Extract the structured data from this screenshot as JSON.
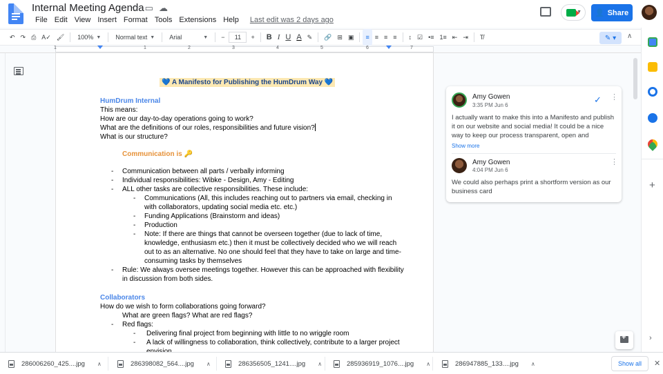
{
  "app": {
    "doc_title": "Internal Meeting Agenda",
    "menu": [
      "File",
      "Edit",
      "View",
      "Insert",
      "Format",
      "Tools",
      "Extensions",
      "Help"
    ],
    "last_edit": "Last edit was 2 days ago",
    "share_label": "Share"
  },
  "toolbar": {
    "zoom": "100%",
    "style": "Normal text",
    "font": "Arial",
    "font_size": "11",
    "bold": "B",
    "italic": "I",
    "underline": "U",
    "text_color": "A"
  },
  "ruler": {
    "marks": [
      "1",
      "1",
      "2",
      "3",
      "4",
      "5",
      "6",
      "7"
    ]
  },
  "document": {
    "title_heart_left": "💙",
    "title": "A Manifesto for Publishing the HumDrum Way",
    "title_heart_right": "💙",
    "section1_heading": "HumDrum Internal",
    "section1_lines": [
      "This means:",
      "How are our day-to-day operations going to work?",
      "What are the definitions of our roles, responsibilities and future vision?",
      "What is our structure?"
    ],
    "subheading": "Communication is",
    "subheading_icon": "🔑",
    "bullets": [
      "Communication between all parts / verbally informing",
      "Individual responsibilities: Wibke - Design, Amy - Editing",
      "ALL other tasks are collective responsibilities. These include:"
    ],
    "sub_bullets": [
      "Communications (All, this includes reaching out to partners via email, checking in with collaborators, updating social media etc. etc.)",
      "Funding Applications (Brainstorm and ideas)",
      "Production",
      "Note: If there are things that cannot be overseen together (due to lack of time, knowledge, enthusiasm etc.) then it must be collectively decided who we will reach out to as an alternative. No one should feel that they have to take on large and time-consuming tasks by themselves"
    ],
    "rule_bullet": "Rule: We always oversee meetings together. However this can be approached with flexibility in discussion from both sides.",
    "section2_heading": "Collaborators",
    "section2_line": "How do we wish to form collaborations going forward?",
    "section2_indent": "What are green flags? What are red flags?",
    "red_flags": "Red flags:",
    "red_flag_items": [
      "Delivering final project from beginning with little to no wriggle room",
      "A lack of willingness to collaboration, think collectively, contribute to a larger project envision"
    ]
  },
  "comments": [
    {
      "author": "Amy Gowen",
      "time": "3:35 PM Jun 6",
      "text": "I actually want to make this into a Manifesto and publish it on our website and social media! It could be a nice way to keep our process transparent, open and",
      "show_more": "Show more"
    },
    {
      "author": "Amy Gowen",
      "time": "4:04 PM Jun 6",
      "text": "We could also perhaps print a shortform version as our business card"
    }
  ],
  "downloads": {
    "items": [
      "286006260_425....jpg",
      "286398082_564....jpg",
      "286356505_1241....jpg",
      "285936919_1076....jpg",
      "286947885_133....jpg"
    ],
    "show_all": "Show all"
  }
}
